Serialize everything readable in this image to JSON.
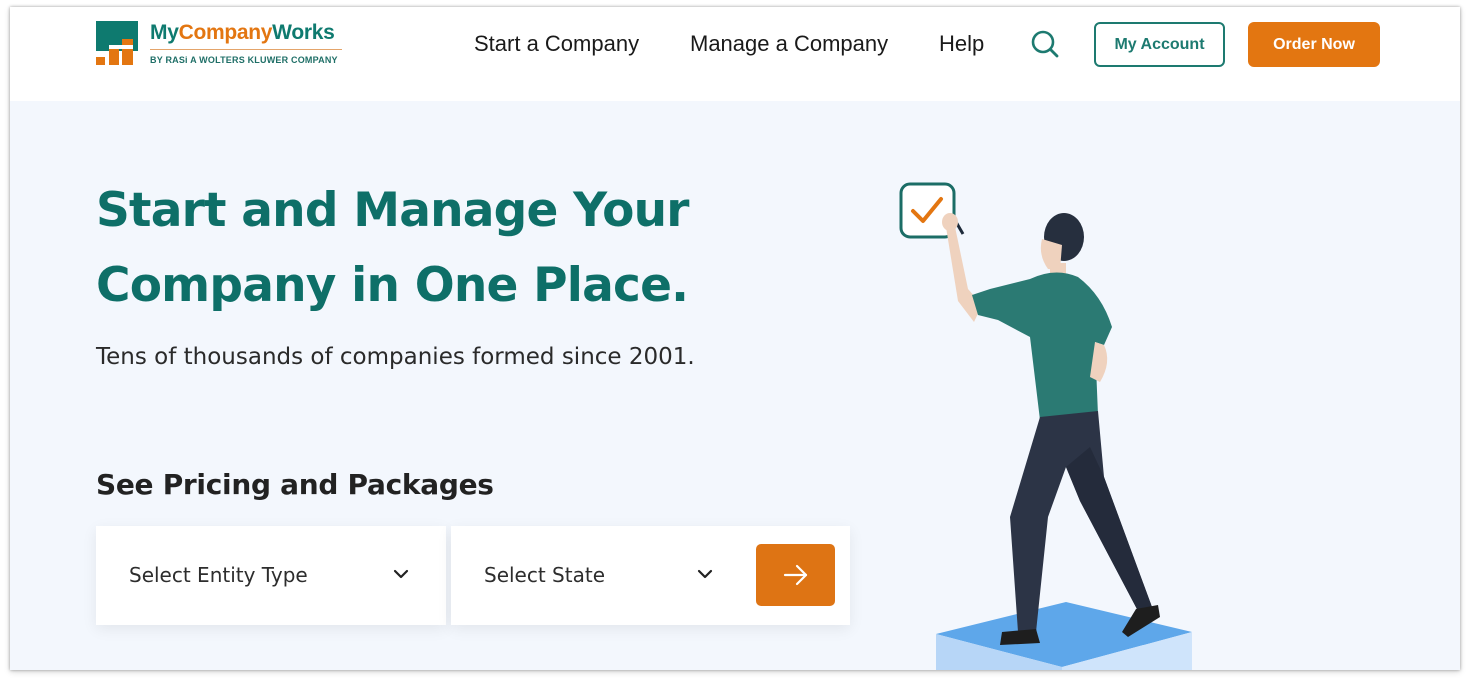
{
  "brand": {
    "name_my": "My",
    "name_company": "Company",
    "name_works": "Works",
    "tagline": "BY RASi A WOLTERS KLUWER COMPANY",
    "colors": {
      "teal": "#0e7a6f",
      "orange": "#e37611"
    }
  },
  "nav": {
    "items": [
      {
        "label": "Start a Company"
      },
      {
        "label": "Manage a Company"
      },
      {
        "label": "Help"
      }
    ],
    "search_icon": "search-icon",
    "my_account_label": "My Account",
    "order_now_label": "Order Now"
  },
  "hero": {
    "title_line1": "Start and Manage Your",
    "title_line2": "Company in One Place.",
    "subtitle": "Tens of thousands of companies formed since 2001."
  },
  "pricing": {
    "heading": "See Pricing and Packages",
    "entity_select": {
      "label": "Select Entity Type",
      "icon": "chevron-down-icon"
    },
    "state_select": {
      "label": "Select State",
      "icon": "chevron-down-icon"
    },
    "submit_icon": "arrow-right-icon"
  }
}
